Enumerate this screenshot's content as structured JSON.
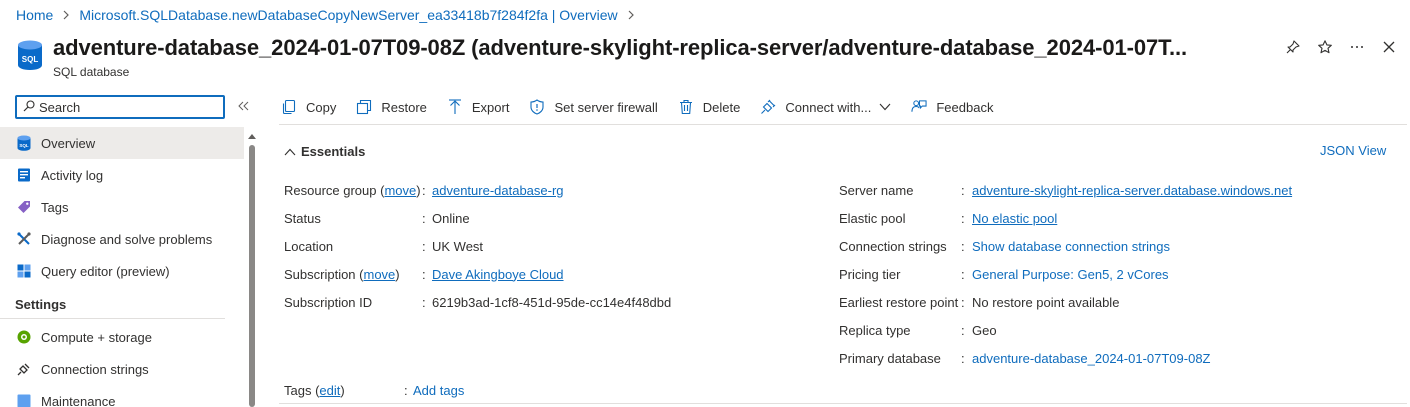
{
  "breadcrumb": {
    "home": "Home",
    "deployment": "Microsoft.SQLDatabase.newDatabaseCopyNewServer_ea33418b7f284f2fa | Overview"
  },
  "header": {
    "title": "adventure-database_2024-01-07T09-08Z (adventure-skylight-replica-server/adventure-database_2024-01-07T...",
    "subtitle": "SQL database",
    "icon": "sql-database-icon",
    "actions": [
      "pin-icon",
      "star-icon",
      "more-icon",
      "close-icon"
    ]
  },
  "search": {
    "placeholder": "Search",
    "value": ""
  },
  "sidebar": {
    "items": [
      {
        "label": "Overview",
        "icon": "sql-database-icon",
        "active": true
      },
      {
        "label": "Activity log",
        "icon": "activity-log-icon"
      },
      {
        "label": "Tags",
        "icon": "tag-icon"
      },
      {
        "label": "Diagnose and solve problems",
        "icon": "wrench-icon"
      },
      {
        "label": "Query editor (preview)",
        "icon": "query-editor-icon"
      }
    ],
    "settings_heading": "Settings",
    "settings_items": [
      {
        "label": "Compute + storage",
        "icon": "compute-icon"
      },
      {
        "label": "Connection strings",
        "icon": "plug-icon"
      },
      {
        "label": "Maintenance",
        "icon": "maintenance-icon"
      }
    ]
  },
  "toolbar": {
    "copy": "Copy",
    "restore": "Restore",
    "export": "Export",
    "firewall": "Set server firewall",
    "delete": "Delete",
    "connect": "Connect with...",
    "feedback": "Feedback"
  },
  "essentials": {
    "heading": "Essentials",
    "json_view": "JSON View",
    "left": {
      "resource_group_label": "Resource group",
      "move": "move",
      "resource_group_value": "adventure-database-rg",
      "status_label": "Status",
      "status_value": "Online",
      "location_label": "Location",
      "location_value": "UK West",
      "subscription_label": "Subscription",
      "subscription_value": "Dave Akingboye Cloud",
      "subscription_id_label": "Subscription ID",
      "subscription_id_value": "6219b3ad-1cf8-451d-95de-cc14e4f48dbd"
    },
    "right": {
      "server_name_label": "Server name",
      "server_name_value": "adventure-skylight-replica-server.database.windows.net",
      "elastic_pool_label": "Elastic pool",
      "elastic_pool_value": "No elastic pool",
      "connection_strings_label": "Connection strings",
      "connection_strings_value": "Show database connection strings",
      "pricing_tier_label": "Pricing tier",
      "pricing_tier_value": "General Purpose: Gen5, 2 vCores",
      "restore_point_label": "Earliest restore point",
      "restore_point_value": "No restore point available",
      "replica_type_label": "Replica type",
      "replica_type_value": "Geo",
      "primary_db_label": "Primary database",
      "primary_db_value": "adventure-database_2024-01-07T09-08Z"
    },
    "tags_label": "Tags",
    "tags_edit": "edit",
    "tags_value": "Add tags"
  },
  "colors": {
    "link": "#0f6cbd",
    "text": "#323130",
    "active_bg": "#edebe9"
  }
}
